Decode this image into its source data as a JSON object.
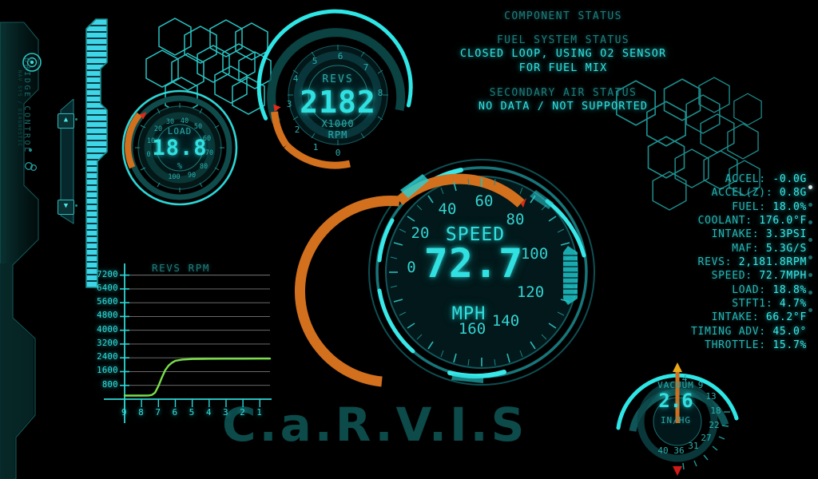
{
  "app": {
    "watermark": "C.a.R.V.I.S",
    "panel_label": "BRIDGE CONTROL",
    "panel_sublabel": "NAV SYS / DIAGNOSTIC"
  },
  "colors": {
    "cyan_bright": "#31e0e0",
    "cyan_mid": "#2aa8a8",
    "teal_dim": "#1f7d7d",
    "orange": "#d2701e",
    "red_marker": "#e02a1a",
    "green_trace": "#7ae04a",
    "watermark": "#0d4a4a",
    "background": "#000000"
  },
  "status": {
    "title": "COMPONENT STATUS",
    "groups": [
      {
        "heading": "FUEL SYSTEM STATUS",
        "line1": "CLOSED LOOP, USING O2 SENSOR",
        "line2": "FOR FUEL MIX"
      },
      {
        "heading": "SECONDARY AIR STATUS",
        "line1": "NO DATA / NOT SUPPORTED",
        "line2": ""
      }
    ]
  },
  "readouts": [
    {
      "label": "ACCEL:",
      "value": "-0.0G"
    },
    {
      "label": "ACCEL(Z):",
      "value": "0.8G"
    },
    {
      "label": "FUEL:",
      "value": "18.0%"
    },
    {
      "label": "COOLANT:",
      "value": "176.0°F"
    },
    {
      "label": "INTAKE:",
      "value": "3.3PSI"
    },
    {
      "label": "MAF:",
      "value": "5.3G/S"
    },
    {
      "label": "REVS:",
      "value": "2,181.8RPM"
    },
    {
      "label": "SPEED:",
      "value": "72.7MPH"
    },
    {
      "label": "LOAD:",
      "value": "18.8%"
    },
    {
      "label": "STFT1:",
      "value": "4.7%"
    },
    {
      "label": "INTAKE:",
      "value": "66.2°F"
    },
    {
      "label": "TIMING ADV:",
      "value": "45.0°"
    },
    {
      "label": "THROTTLE:",
      "value": "15.7%"
    }
  ],
  "gauges": {
    "load": {
      "name": "LOAD",
      "value": "18.8",
      "unit": "%",
      "ticks": [
        "0",
        "10",
        "20",
        "30",
        "40",
        "50",
        "60",
        "70",
        "80",
        "90",
        "100"
      ],
      "min": 0,
      "max": 100,
      "current": 18.8
    },
    "revs": {
      "name": "REVS",
      "value": "2182",
      "unit_line1": "X1000",
      "unit_line2": "RPM",
      "ticks": [
        "0",
        "1",
        "2",
        "3",
        "4",
        "5",
        "6",
        "7",
        "8"
      ],
      "min": 0,
      "max": 8,
      "current": 2.18
    },
    "speed": {
      "name": "SPEED",
      "value": "72.7",
      "unit": "MPH",
      "ticks": [
        "0",
        "20",
        "40",
        "60",
        "80",
        "100",
        "120",
        "140",
        "160"
      ],
      "min": 0,
      "max": 160,
      "current": 72.7
    },
    "vacuum": {
      "name": "VACUUM",
      "value": "2.6",
      "unit": "IN/HG",
      "ticks": [
        "4",
        "9",
        "13",
        "18",
        "22",
        "27",
        "31",
        "36",
        "40"
      ],
      "min": 0,
      "max": 40,
      "current": 2.6
    }
  },
  "chart_data": {
    "type": "line",
    "title": "REVS RPM",
    "xlabel": "",
    "ylabel": "",
    "grid": true,
    "legend": false,
    "ylim": [
      0,
      7600
    ],
    "yticks": [
      800,
      1600,
      2400,
      3200,
      4000,
      4800,
      5600,
      6400,
      7200
    ],
    "xticks": [
      "9",
      "8",
      "7",
      "6",
      "5",
      "4",
      "3",
      "2",
      "1"
    ],
    "x": [
      9,
      8.5,
      8,
      7.6,
      7.4,
      7.2,
      7.0,
      6.8,
      6.6,
      6.4,
      6.2,
      6.0,
      5.6,
      5.0,
      4.0,
      3.0,
      2.0,
      1.0,
      0.4
    ],
    "series": [
      {
        "name": "REVS RPM",
        "color": "#7ae04a",
        "values": [
          210,
          210,
          210,
          215,
          240,
          380,
          760,
          1250,
          1680,
          1950,
          2120,
          2230,
          2300,
          2330,
          2345,
          2350,
          2350,
          2352,
          2352
        ]
      }
    ]
  },
  "controls": {
    "scroll_up": "▲",
    "scroll_down": "▼"
  }
}
